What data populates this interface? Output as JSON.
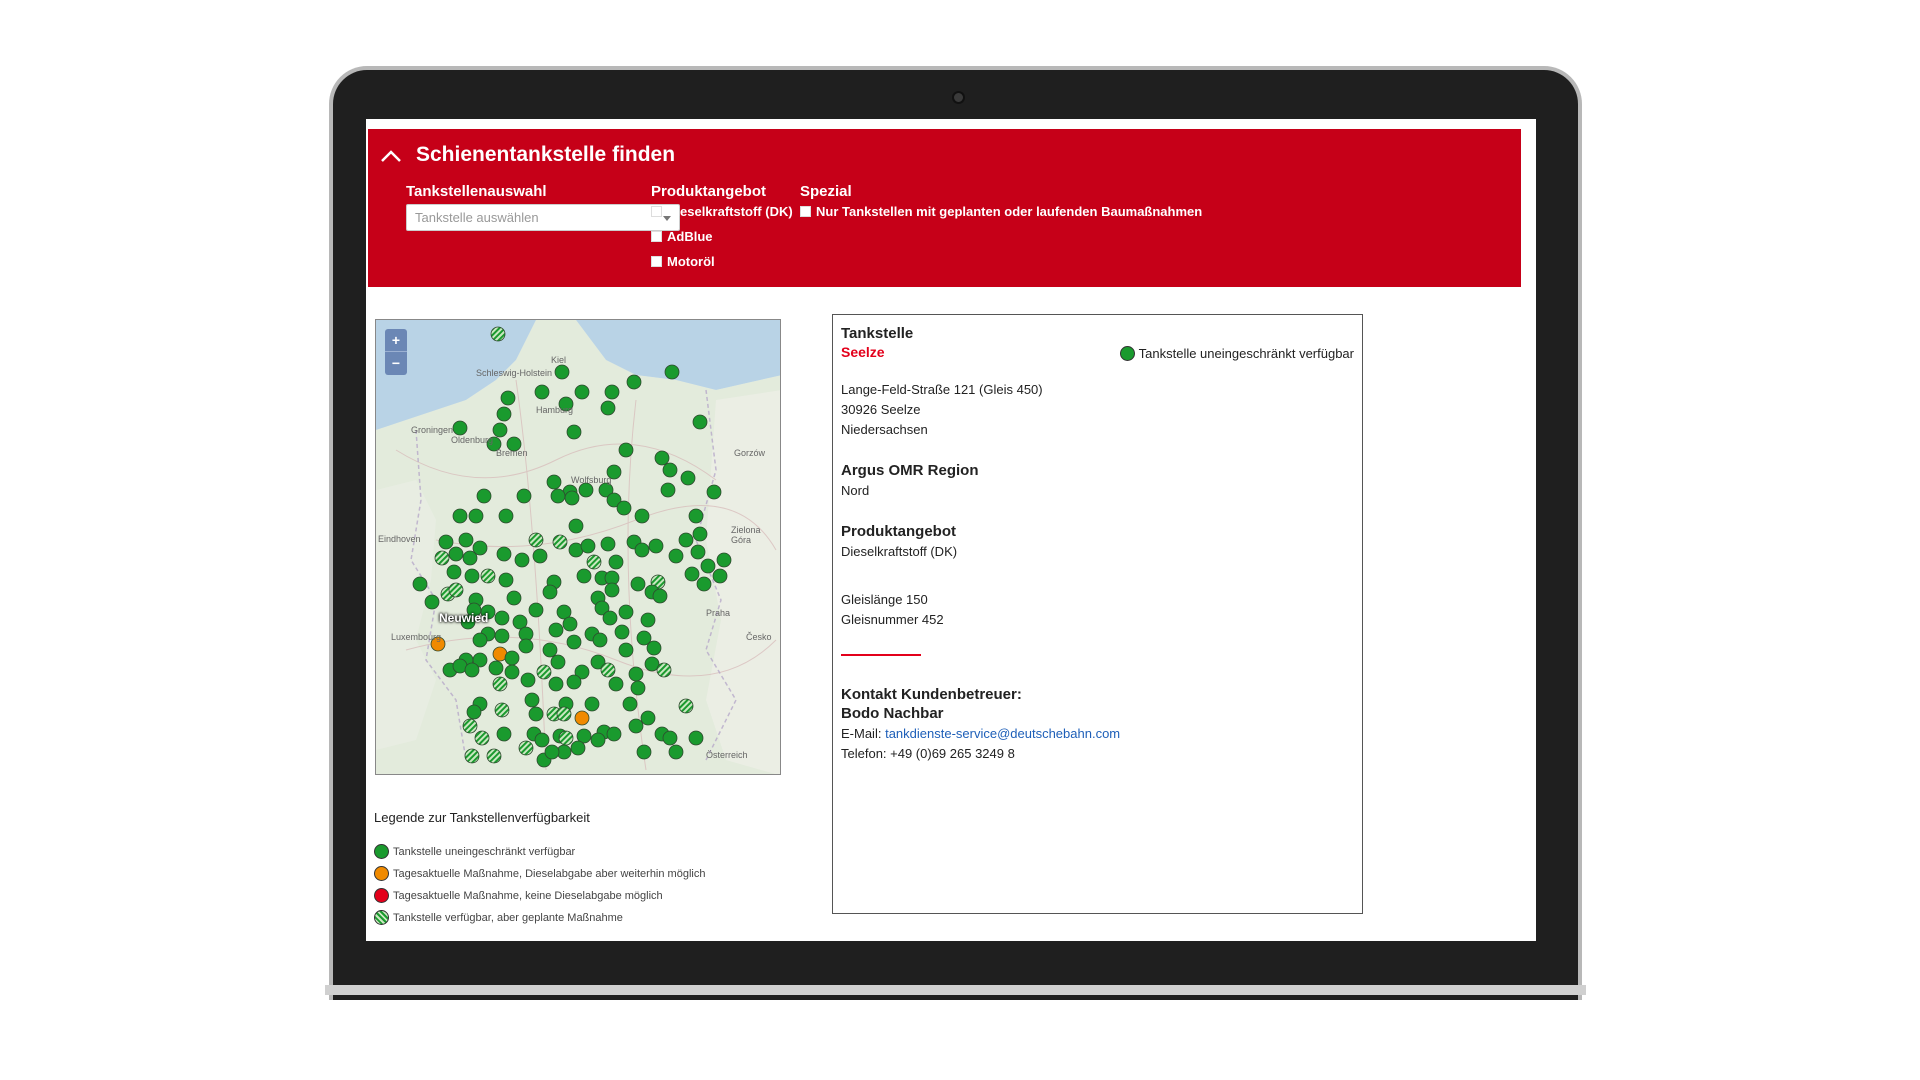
{
  "header": {
    "title": "Schienentankstelle finden",
    "station_select": {
      "label": "Tankstellenauswahl",
      "placeholder": "Tankstelle auswählen"
    },
    "products": {
      "label": "Produktangebot",
      "options": [
        "Dieselkraftstoff (DK)",
        "AdBlue",
        "Motoröl"
      ]
    },
    "special": {
      "label": "Spezial",
      "options": [
        "Nur Tankstellen mit geplanten oder laufenden Baumaßnahmen"
      ]
    }
  },
  "map": {
    "zoom_in": "+",
    "zoom_out": "−",
    "highlight_city": "Neuwied",
    "place_labels": [
      "Groningen",
      "Oldenburg",
      "Bremen",
      "Hamburg",
      "Wolfsburg",
      "Eindhoven",
      "Luxembourg",
      "Praha",
      "Česko",
      "Österreich",
      "Gorzów",
      "Zielona Góra",
      "Schleswig-Holstein",
      "Kiel"
    ],
    "stations": [
      {
        "status": "green"
      },
      {
        "status": "orange"
      },
      {
        "status": "hatch"
      }
    ]
  },
  "legend": {
    "title": "Legende zur Tankstellenverfügbarkeit",
    "items": [
      {
        "status": "green",
        "label": "Tankstelle uneingeschränkt verfügbar"
      },
      {
        "status": "orange",
        "label": "Tagesaktuelle Maßnahme, Dieselabgabe aber weiterhin möglich"
      },
      {
        "status": "red",
        "label": "Tagesaktuelle Maßnahme, keine Dieselabgabe möglich"
      },
      {
        "status": "hatch",
        "label": "Tankstelle verfügbar, aber geplante Maßnahme"
      }
    ]
  },
  "detail": {
    "heading": "Tankstelle",
    "name": "Seelze",
    "status_label": "Tankstelle uneingeschränkt verfügbar",
    "address": [
      "Lange-Feld-Straße 121 (Gleis 450)",
      "30926 Seelze",
      "Niedersachsen"
    ],
    "region_heading": "Argus OMR Region",
    "region": "Nord",
    "products_heading": "Produktangebot",
    "products": "Dieselkraftstoff (DK)",
    "track_length": "Gleislänge 150",
    "track_number": "Gleisnummer 452",
    "contact_heading": "Kontakt Kundenbetreuer:",
    "contact_name": "Bodo Nachbar",
    "email_label": "E-Mail:",
    "email": "tankdienste-service@deutschebahn.com",
    "phone": "Telefon: +49 (0)69 265 3249 8"
  },
  "colors": {
    "brand_red": "#c60018",
    "status_green": "#1a9a2e",
    "status_orange": "#f08a00",
    "status_red": "#e3001b",
    "link": "#1e5fb8"
  }
}
